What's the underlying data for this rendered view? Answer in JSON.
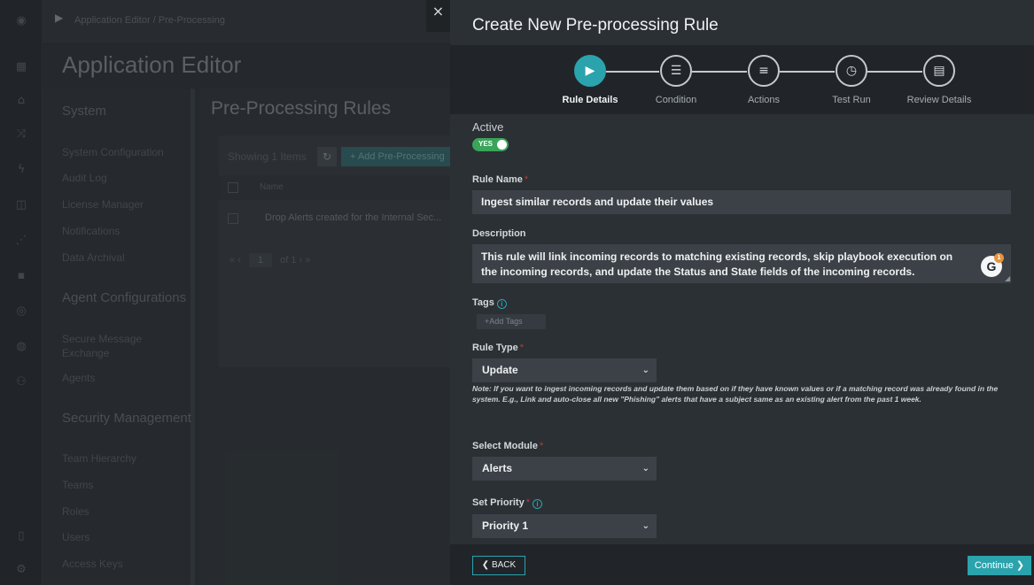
{
  "background": {
    "breadcrumb": "Application Editor / Pre-Processing",
    "app_title": "Application Editor",
    "side_nav": {
      "system_heading": "System",
      "system_items": [
        "System Configuration",
        "Audit Log",
        "License Manager",
        "Notifications",
        "Data Archival"
      ],
      "agent_heading": "Agent Configurations",
      "agent_items": [
        "Secure Message Exchange",
        "Agents"
      ],
      "security_heading": "Security Management",
      "security_items": [
        "Team Hierarchy",
        "Teams",
        "Roles",
        "Users",
        "Access Keys"
      ]
    },
    "content": {
      "title": "Pre-Processing Rules",
      "showing_label": "Showing 1 Items",
      "add_button": "+ Add Pre-Processing",
      "col_name": "Name",
      "row_name": "Drop Alerts created for the Internal Sec...",
      "pager_page": "1",
      "pager_of": "of 1"
    }
  },
  "modal": {
    "title": "Create New Pre-processing Rule",
    "steps": [
      {
        "label": "Rule Details",
        "icon": "play-icon",
        "active": true
      },
      {
        "label": "Condition",
        "icon": "database-icon",
        "active": false
      },
      {
        "label": "Actions",
        "icon": "sliders-icon",
        "active": false
      },
      {
        "label": "Test Run",
        "icon": "calendar-clock-icon",
        "active": false
      },
      {
        "label": "Review Details",
        "icon": "document-icon",
        "active": false
      }
    ],
    "form": {
      "active_label": "Active",
      "active_toggle": "YES",
      "rule_name_label": "Rule Name",
      "rule_name_value": "Ingest similar records and update their values",
      "description_label": "Description",
      "description_value": "This rule will link incoming records to matching existing records, skip playbook execution on the incoming records, and update the Status and State fields of the incoming records.",
      "tags_label": "Tags",
      "tags_placeholder": "+Add Tags",
      "rule_type_label": "Rule Type",
      "rule_type_value": "Update",
      "note": "Note: If you want to ingest incoming records and update them based on if they have known values or if a matching record was already found in the system. E.g., Link and auto-close all new \"Phishing\" alerts that have a subject same as an existing alert from the past 1 week.",
      "module_label": "Select Module",
      "module_value": "Alerts",
      "priority_label": "Set Priority",
      "priority_value": "Priority 1"
    },
    "footer": {
      "back_label": "BACK",
      "continue_label": "Continue"
    },
    "grammarly_count": "1"
  },
  "colors": {
    "accent": "#2aa3ad",
    "toggle_on": "#3aa45a",
    "required": "#c0392b"
  }
}
